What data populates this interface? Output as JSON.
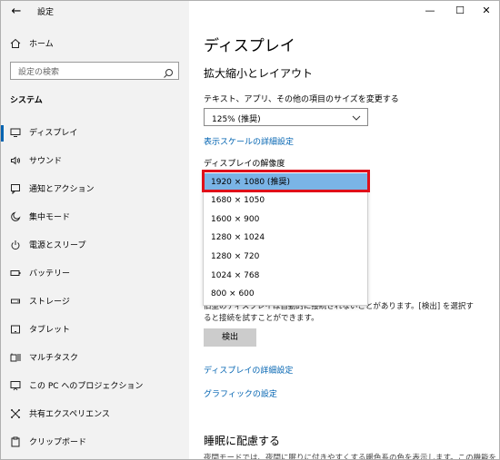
{
  "titlebar": {
    "back_glyph": "←",
    "app_title": "設定",
    "minimize": "—",
    "maximize": "☐",
    "close": "✕"
  },
  "nav": {
    "home_label": "ホーム",
    "search_placeholder": "設定の検索",
    "section_label": "システム",
    "items": [
      {
        "label": "ディスプレイ",
        "icon": "monitor-icon"
      },
      {
        "label": "サウンド",
        "icon": "speaker-icon"
      },
      {
        "label": "通知とアクション",
        "icon": "notification-icon"
      },
      {
        "label": "集中モード",
        "icon": "moon-icon"
      },
      {
        "label": "電源とスリープ",
        "icon": "power-icon"
      },
      {
        "label": "バッテリー",
        "icon": "battery-icon"
      },
      {
        "label": "ストレージ",
        "icon": "storage-icon"
      },
      {
        "label": "タブレット",
        "icon": "tablet-icon"
      },
      {
        "label": "マルチタスク",
        "icon": "multitask-icon"
      },
      {
        "label": "この PC へのプロジェクション",
        "icon": "projection-icon"
      },
      {
        "label": "共有エクスペリエンス",
        "icon": "share-icon"
      },
      {
        "label": "クリップボード",
        "icon": "clipboard-icon"
      }
    ]
  },
  "main": {
    "page_title": "ディスプレイ",
    "scale_section": "拡大縮小とレイアウト",
    "scale_label": "テキスト、アプリ、その他の項目のサイズを変更する",
    "scale_value": "125% (推奨)",
    "advanced_scale_link": "表示スケールの詳細設定",
    "resolution_label": "ディスプレイの解像度",
    "resolution_options": [
      "1920 × 1080 (推奨)",
      "1680 × 1050",
      "1600 × 900",
      "1280 × 1024",
      "1280 × 720",
      "1024 × 768",
      "800 × 600"
    ],
    "info_text": "旧型のディスプレイは自動的に接続されないことがあります。[検出] を選択すると接続を試すことができます。",
    "detect_button": "検出",
    "advanced_display_link": "ディスプレイの詳細設定",
    "graphics_link": "グラフィックの設定",
    "sleep_section": "睡眠に配慮する",
    "sleep_text": "夜間モードでは、夜間に眠りに付きやすくする暖色系の色を表示します。この機能を"
  },
  "colors": {
    "accent": "#0063b1",
    "highlight": "#e0101a",
    "selected_item": "#7ab4e6",
    "left_pane": "#f2f2f2"
  }
}
